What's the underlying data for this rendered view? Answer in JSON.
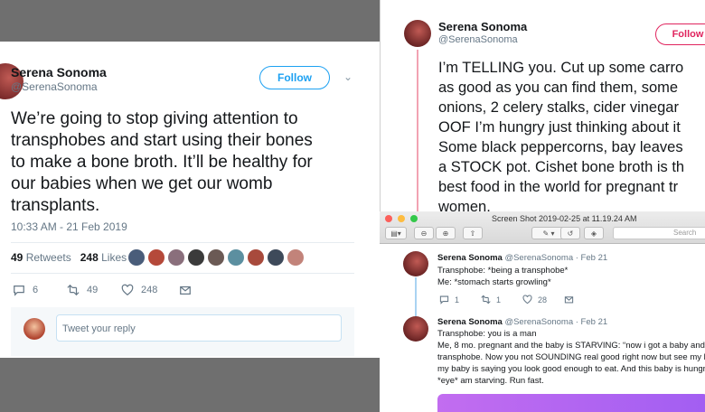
{
  "left_tweet": {
    "name": "Serena Sonoma",
    "handle": "@SerenaSonoma",
    "follow_label": "Follow",
    "text_lines": [
      "We’re going to stop giving attention to",
      "transphobes and start using their bones",
      "to make a bone broth. It’ll be healthy for",
      "our babies when we get our womb",
      "transplants."
    ],
    "timestamp": "10:33 AM - 21 Feb 2019",
    "retweets_count": "49",
    "retweets_label": "Retweets",
    "likes_count": "248",
    "likes_label": "Likes",
    "liker_colors": [
      "#4a5d7a",
      "#b5493a",
      "#8a6f7c",
      "#3b3b3b",
      "#6b5a55",
      "#5c8fa0",
      "#a84a3c",
      "#3e4a5a",
      "#c2837a"
    ],
    "actions": {
      "replies": "6",
      "retweets": "49",
      "likes": "248"
    },
    "reply_placeholder": "Tweet your reply"
  },
  "right_tweet": {
    "name": "Serena Sonoma",
    "handle": "@SerenaSonoma",
    "follow_label": "Follow",
    "text_lines": [
      "I’m TELLING you. Cut up some carro",
      "as good as you can find them, some",
      "onions, 2 celery stalks, cider vinegar",
      "OOF I’m hungry just thinking about it",
      "Some black peppercorns, bay leaves",
      "a STOCK pot. Cishet bone broth is th",
      "best food in the world for pregnant tr",
      "women."
    ]
  },
  "mac_window": {
    "title": "Screen Shot 2019-02-25 at 11.19.24 AM",
    "search_placeholder": "Search",
    "tweets": [
      {
        "name": "Serena Sonoma",
        "handle_date": "@SerenaSonoma · Feb 21",
        "lines": [
          "Transphobe: *being a transphobe*",
          "Me: *stomach starts growling*"
        ],
        "replies": "1",
        "retweets": "1",
        "likes": "28"
      },
      {
        "name": "Serena Sonoma",
        "handle_date": "@SerenaSonoma · Feb 21",
        "lines": [
          "Transphobe: you is a man",
          "Me, 8 mo. pregnant and the baby is STARVING: “now i got a baby and I",
          "transphobe. Now you not SOUNDING real good right now but see my b",
          "my baby is saying you look good enough to eat. And this baby is hungry",
          "*eye* am starving. Run fast."
        ]
      }
    ]
  }
}
